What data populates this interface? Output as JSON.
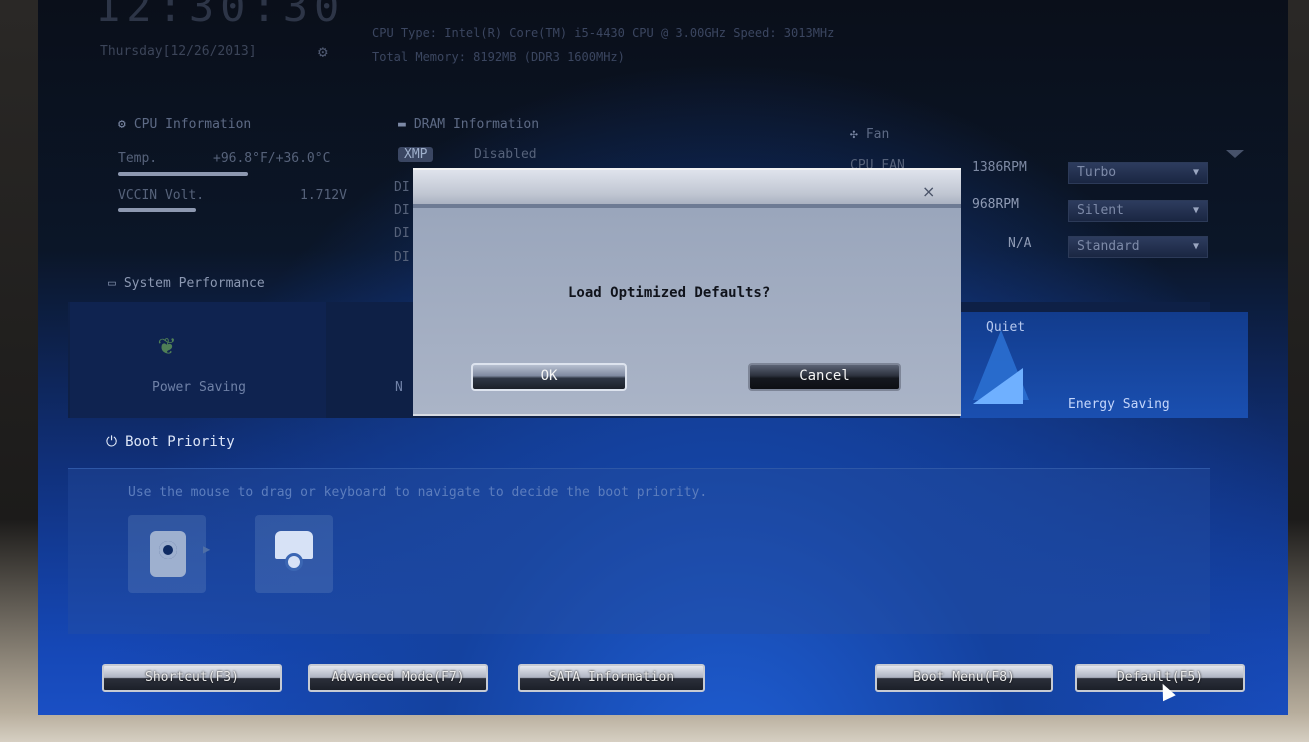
{
  "header": {
    "clock": "12:30:30",
    "date": "Thursday[12/26/2013]",
    "cpu_type": "CPU Type: Intel(R) Core(TM) i5-4430 CPU @ 3.00GHz   Speed: 3013MHz",
    "total_memory": "Total Memory: 8192MB (DDR3 1600MHz)"
  },
  "cpu_info": {
    "title": "CPU Information",
    "temp_label": "Temp.",
    "temp_value": "+96.8°F/+36.0°C",
    "vccin_label": "VCCIN Volt.",
    "vccin_value": "1.712V"
  },
  "dram_info": {
    "title": "DRAM Information",
    "xmp_label": "XMP",
    "xmp_value": "Disabled",
    "dimm_rows": [
      "DI",
      "DI",
      "DI",
      "DI"
    ]
  },
  "fan": {
    "title": "Fan",
    "rows": [
      {
        "label": "CPU FAN",
        "speed": "1386RPM",
        "mode": "Turbo"
      },
      {
        "label": "",
        "speed": "968RPM",
        "mode": "Silent"
      },
      {
        "label": "",
        "speed": "N/A",
        "mode": "Standard"
      }
    ]
  },
  "system_performance": {
    "title": "System Performance",
    "tiles": {
      "power_saving": "Power Saving",
      "normal_prefix": "N",
      "quiet": "Quiet",
      "energy_saving": "Energy Saving"
    }
  },
  "boot_priority": {
    "title": "Boot Priority",
    "hint": "Use the mouse to drag or keyboard to navigate to decide the boot priority."
  },
  "dialog": {
    "message": "Load Optimized Defaults?",
    "ok_label": "OK",
    "cancel_label": "Cancel",
    "close_symbol": "×"
  },
  "bottom_bar": {
    "shortcut": "Shortcut(F3)",
    "advanced_mode": "Advanced Mode(F7)",
    "sata_information": "SATA Information",
    "boot_menu": "Boot Menu(F8)",
    "default": "Default(F5)"
  },
  "colors": {
    "screen_bg": "#1547b5",
    "dialog_body": "#aab4c7",
    "button_text": "#ececec"
  }
}
